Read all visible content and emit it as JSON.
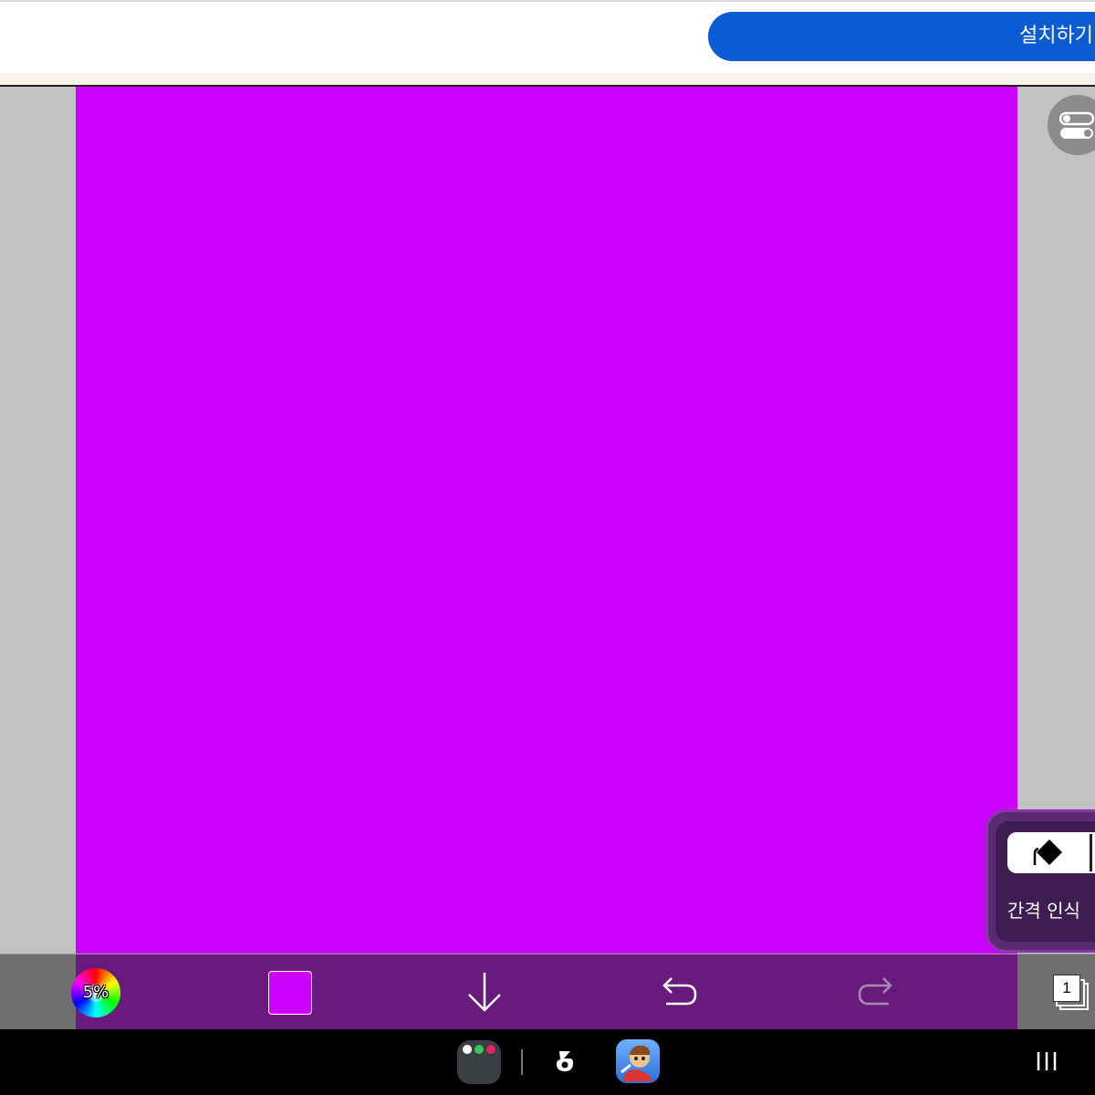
{
  "ad_banner": {
    "install_label": "설치하기",
    "install_color": "#0b5bd3"
  },
  "canvas": {
    "fill_color": "#cc00ff",
    "workspace_color": "#c2c2c2"
  },
  "settings": {
    "icon": "toggle-switches-icon"
  },
  "tool_panel": {
    "fill_tool_icon": "paint-bucket-icon",
    "gap_detect_label": "간격 인식"
  },
  "toolbar": {
    "opacity_label": "5%",
    "color_wheel_icon": "color-wheel-icon",
    "current_color": "#cc00ff",
    "download_icon": "arrow-down-icon",
    "undo_icon": "undo-icon",
    "redo_icon": "redo-icon",
    "layer_count": "1",
    "toolbar_color": "#691a7d"
  },
  "nav_bar": {
    "recents_icon": "recents-icon",
    "apps": [
      "app-folder",
      "logo-app",
      "game-app"
    ]
  }
}
